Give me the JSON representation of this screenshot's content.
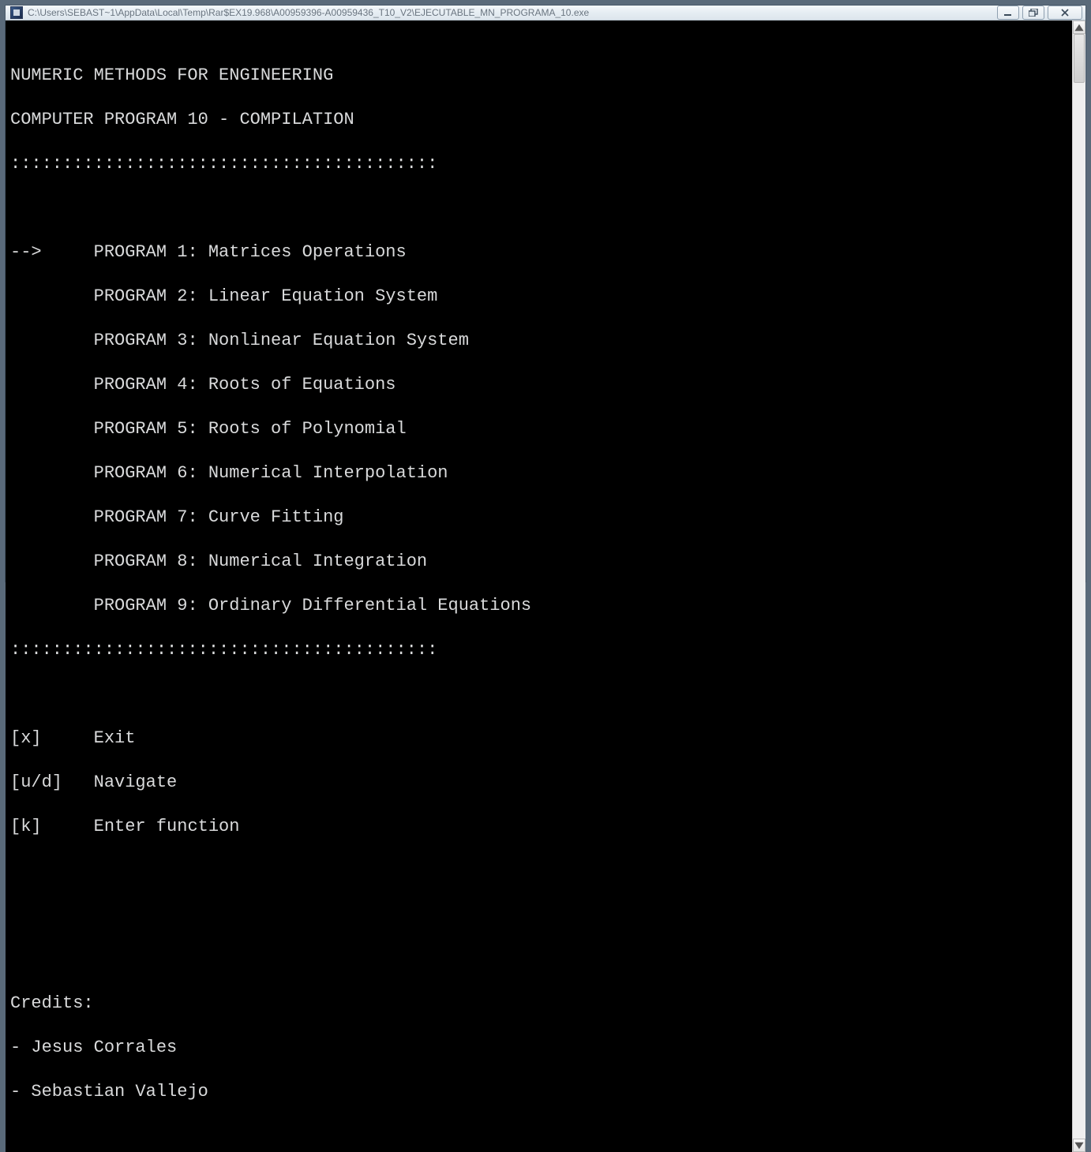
{
  "window": {
    "title": "C:\\Users\\SEBAST~1\\AppData\\Local\\Temp\\Rar$EX19.968\\A00959396-A00959436_T10_V2\\EJECUTABLE_MN_PROGRAMA_10.exe"
  },
  "header": {
    "line1": "NUMERIC METHODS FOR ENGINEERING",
    "line2": "COMPUTER PROGRAM 10 - COMPILATION"
  },
  "separator": ":::::::::::::::::::::::::::::::::::::::::",
  "menu": {
    "selected_index": 0,
    "pointer": "-->",
    "items": [
      {
        "label": "PROGRAM 1: Matrices Operations"
      },
      {
        "label": "PROGRAM 2: Linear Equation System"
      },
      {
        "label": "PROGRAM 3: Nonlinear Equation System"
      },
      {
        "label": "PROGRAM 4: Roots of Equations"
      },
      {
        "label": "PROGRAM 5: Roots of Polynomial"
      },
      {
        "label": "PROGRAM 6: Numerical Interpolation"
      },
      {
        "label": "PROGRAM 7: Curve Fitting"
      },
      {
        "label": "PROGRAM 8: Numerical Integration"
      },
      {
        "label": "PROGRAM 9: Ordinary Differential Equations"
      }
    ]
  },
  "controls": [
    {
      "key": "[x]",
      "desc": "Exit"
    },
    {
      "key": "[u/d]",
      "desc": "Navigate"
    },
    {
      "key": "[k]",
      "desc": "Enter function"
    }
  ],
  "credits": {
    "heading": "Credits:",
    "lines": [
      "- Jesus Corrales",
      "- Sebastian Vallejo"
    ]
  }
}
